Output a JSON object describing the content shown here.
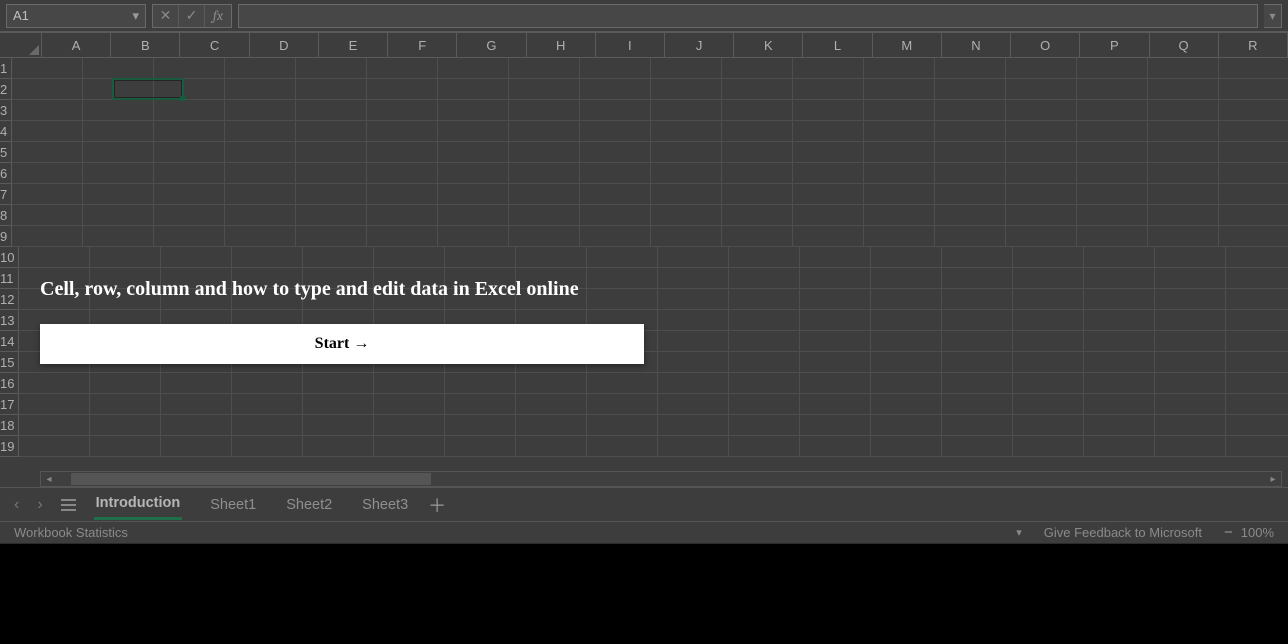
{
  "formula_bar": {
    "name_box_value": "A1",
    "cancel_glyph": "✕",
    "enter_glyph": "✓",
    "fx_label": "fx"
  },
  "columns": [
    "A",
    "B",
    "C",
    "D",
    "E",
    "F",
    "G",
    "H",
    "I",
    "J",
    "K",
    "L",
    "M",
    "N",
    "O",
    "P",
    "Q",
    "R"
  ],
  "row_count": 19,
  "selected_cell": {
    "col_index": 1,
    "row_index": 1
  },
  "tabs": {
    "items": [
      "Introduction",
      "Sheet1",
      "Sheet2",
      "Sheet3"
    ],
    "active_index": 0
  },
  "status": {
    "left": "Workbook Statistics",
    "feedback": "Give Feedback to Microsoft",
    "zoom": "100%"
  },
  "overlay": {
    "title": "Cell, row, column and how to type and edit data in Excel online",
    "button": "Start →"
  }
}
